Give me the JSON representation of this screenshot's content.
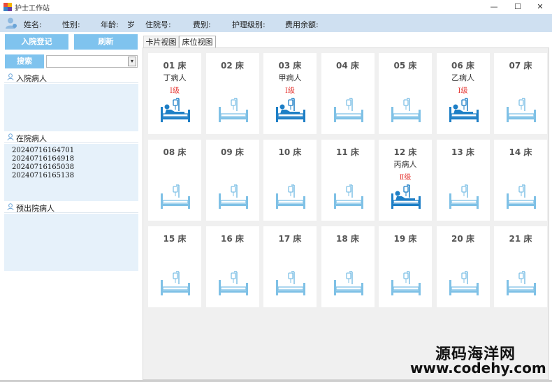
{
  "window": {
    "title": "护士工作站",
    "minimize": "—",
    "maximize": "☐",
    "close": "✕"
  },
  "infobar": {
    "name_label": "姓名:",
    "gender_label": "性别:",
    "age_label": "年龄:",
    "age_unit": "岁",
    "bed_no_label": "住院号:",
    "cost_label": "费别:",
    "care_level_label": "护理级别:",
    "balance_label": "费用余额:"
  },
  "left": {
    "admit_button": "入院登记",
    "refresh_button": "刷新",
    "search_button": "搜索",
    "search_arrow": "▾",
    "sections": {
      "admitting": {
        "title": "入院病人"
      },
      "in_hospital": {
        "title": "在院病人",
        "patients": [
          "20240716164701",
          "20240716164918",
          "20240716165038",
          "20240716165138"
        ]
      },
      "pre_discharge": {
        "title": "预出院病人"
      }
    }
  },
  "tabs": {
    "card_view": "卡片视图",
    "bed_view": "床位视图"
  },
  "beds": [
    {
      "num": "01 床",
      "name": "丁病人",
      "level": "Ⅰ级",
      "occupied": true
    },
    {
      "num": "02 床",
      "name": "",
      "level": "",
      "occupied": false
    },
    {
      "num": "03 床",
      "name": "甲病人",
      "level": "Ⅰ级",
      "occupied": true
    },
    {
      "num": "04 床",
      "name": "",
      "level": "",
      "occupied": false
    },
    {
      "num": "05 床",
      "name": "",
      "level": "",
      "occupied": false
    },
    {
      "num": "06 床",
      "name": "乙病人",
      "level": "Ⅰ级",
      "occupied": true
    },
    {
      "num": "07 床",
      "name": "",
      "level": "",
      "occupied": false
    },
    {
      "num": "08 床",
      "name": "",
      "level": "",
      "occupied": false
    },
    {
      "num": "09 床",
      "name": "",
      "level": "",
      "occupied": false
    },
    {
      "num": "10 床",
      "name": "",
      "level": "",
      "occupied": false
    },
    {
      "num": "11 床",
      "name": "",
      "level": "",
      "occupied": false
    },
    {
      "num": "12 床",
      "name": "丙病人",
      "level": "Ⅱ级",
      "occupied": true
    },
    {
      "num": "13 床",
      "name": "",
      "level": "",
      "occupied": false
    },
    {
      "num": "14 床",
      "name": "",
      "level": "",
      "occupied": false
    },
    {
      "num": "15 床",
      "name": "",
      "level": "",
      "occupied": false
    },
    {
      "num": "16 床",
      "name": "",
      "level": "",
      "occupied": false
    },
    {
      "num": "17 床",
      "name": "",
      "level": "",
      "occupied": false
    },
    {
      "num": "18 床",
      "name": "",
      "level": "",
      "occupied": false
    },
    {
      "num": "19 床",
      "name": "",
      "level": "",
      "occupied": false
    },
    {
      "num": "20 床",
      "name": "",
      "level": "",
      "occupied": false
    },
    {
      "num": "21 床",
      "name": "",
      "level": "",
      "occupied": false
    }
  ],
  "watermark": {
    "line1": "源码海洋网",
    "line2": "www.codehy.com"
  },
  "colors": {
    "accent": "#7fc3ee",
    "info_bar": "#cfe0f1",
    "occupied_bed": "#1e7fc6",
    "empty_bed": "#7fc1e6",
    "level_text": "#e53935"
  }
}
